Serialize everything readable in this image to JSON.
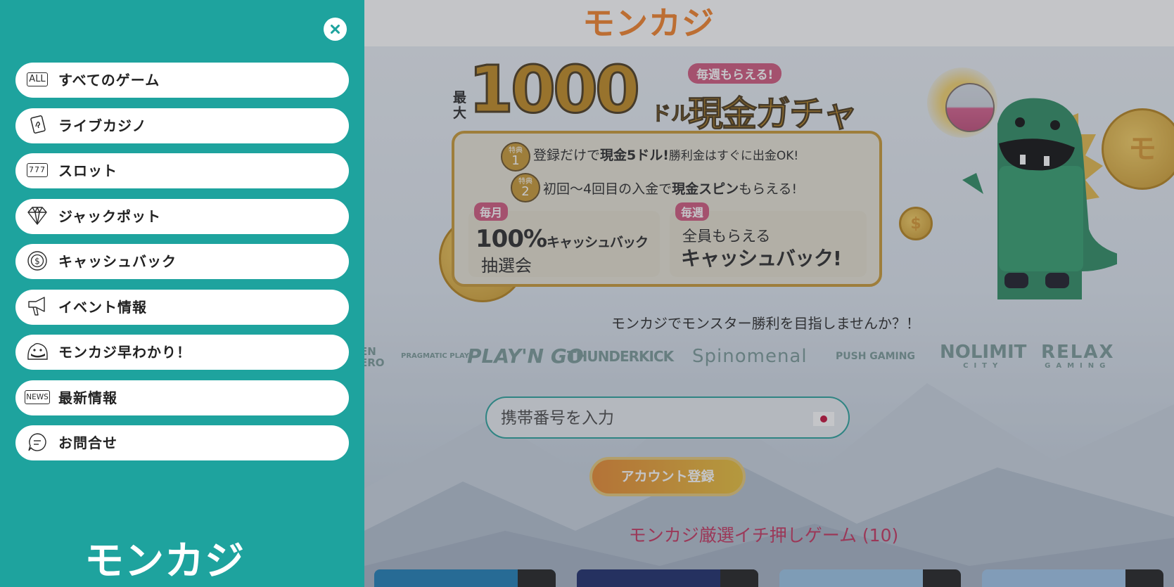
{
  "header": {
    "logo_text": "モンカジ"
  },
  "banner": {
    "max_label": "最大",
    "amount": "1000",
    "currency": "ドル",
    "weekly_badge": "毎週もらえる!",
    "headline": "現金ガチャ",
    "perk1_badge_top": "特典",
    "perk1_badge_num": "1",
    "perk1_pre": "登録だけで",
    "perk1_bold": "現金5ドル!",
    "perk1_post": "勝利金はすぐに出金OK!",
    "perk2_badge_top": "特典",
    "perk2_badge_num": "2",
    "perk2_pre": "初回〜4回目の入金で",
    "perk2_bold": "現金スピン",
    "perk2_post": "もらえる!",
    "box1_tag": "毎月",
    "box1_big": "100%",
    "box1_big_suffix": "キャッシュバック",
    "box1_sub": "抽選会",
    "box2_tag": "毎週",
    "box2_line1": "全員もらえる",
    "box2_line2": "キャッシュバック!"
  },
  "tagline": "モンカジでモンスター勝利を目指しませんか？！",
  "providers": [
    {
      "name": "GOLDEN HERO",
      "text": "EN\nERO"
    },
    {
      "name": "PRAGMATIC PLAY",
      "text": "PRAGMATIC PLAY"
    },
    {
      "name": "PLAY'N GO",
      "text": "PLAY'N GO"
    },
    {
      "name": "THUNDERKICK",
      "text": "THUNDERKICK"
    },
    {
      "name": "Spinomenal",
      "text": "Spinomenal"
    },
    {
      "name": "PUSH GAMING",
      "text": "PUSH GAMING"
    },
    {
      "name": "NOLIMIT CITY",
      "text": "NOLIMIT",
      "sub": "CITY"
    },
    {
      "name": "RELAX GAMING",
      "text": "RELAX",
      "sub": "GAMING"
    }
  ],
  "signup": {
    "phone_placeholder": "携帯番号を入力",
    "register_button": "アカウント登録"
  },
  "featured_title": "モンカジ厳選イチ押しゲーム (10)",
  "menu": {
    "close_icon": "close-icon",
    "items": [
      {
        "label": "すべてのゲーム",
        "icon": "all-games-icon",
        "icon_text": "ALL"
      },
      {
        "label": "ライブカジノ",
        "icon": "playing-card-icon"
      },
      {
        "label": "スロット",
        "icon": "slot-machine-icon",
        "icon_text": "777"
      },
      {
        "label": "ジャックポット",
        "icon": "diamond-icon"
      },
      {
        "label": "キャッシュバック",
        "icon": "cashback-coin-icon"
      },
      {
        "label": "イベント情報",
        "icon": "megaphone-icon"
      },
      {
        "label": "モンカジ早わかり！",
        "icon": "monster-face-icon"
      },
      {
        "label": "最新情報",
        "icon": "news-icon",
        "icon_text": "NEWS"
      },
      {
        "label": "お問合せ",
        "icon": "chat-bubble-icon"
      }
    ],
    "footer_logo_text": "モンカジ"
  },
  "colors": {
    "drawer_bg": "#1ea39e",
    "brand_orange": "#f4832a",
    "accent_pink": "#c5365f",
    "gold": "#c08a22"
  }
}
